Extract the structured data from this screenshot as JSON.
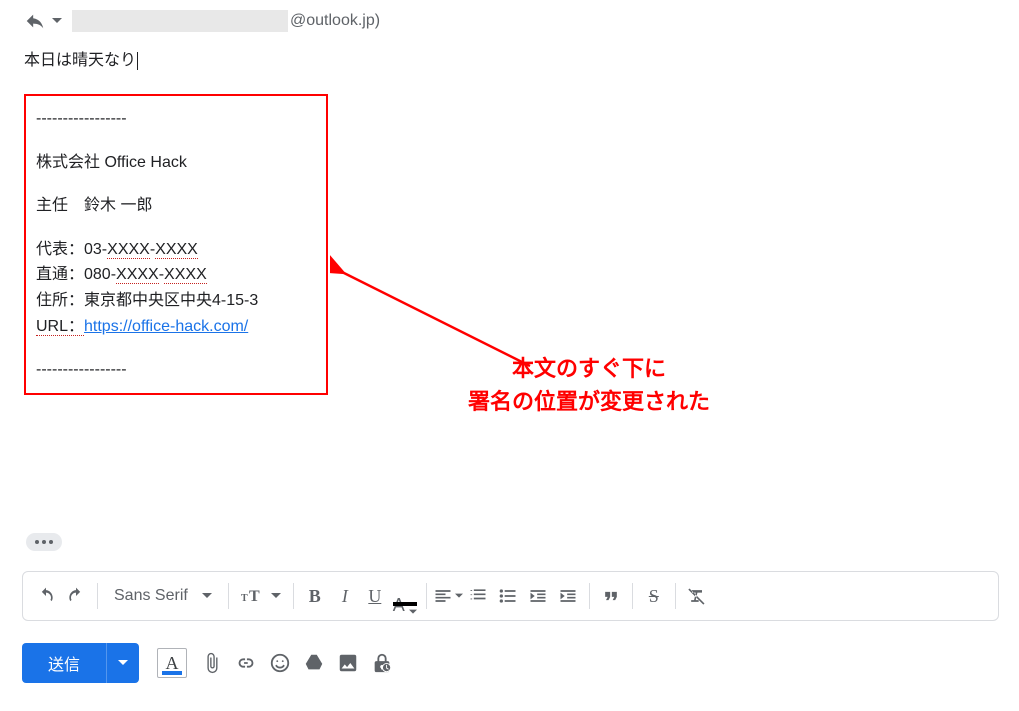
{
  "reply": {
    "recipient_domain": "@outlook.jp)"
  },
  "body": {
    "text": "本日は晴天なり"
  },
  "signature": {
    "sep": "-----------------",
    "company": "株式会社 Office  Hack",
    "role_name": "主任　鈴木 一郎",
    "tel_label": "代表：03-",
    "tel_x1": "XXXX",
    "tel_dash": "-",
    "tel_x2": "XXXX",
    "direct_label": "直通：080-",
    "direct_x1": "XXXX",
    "direct_x2": "XXXX",
    "address": "住所：東京都中央区中央4-15-3",
    "url_label": "URL：",
    "url_link": "https://office-hack.com/",
    "sep2": "-----------------"
  },
  "annotation": {
    "line1": "本文のすぐ下に",
    "line2": "署名の位置が変更された"
  },
  "toolbar": {
    "font": "Sans Serif"
  },
  "actions": {
    "send": "送信"
  },
  "quoted_toggle": "•••"
}
